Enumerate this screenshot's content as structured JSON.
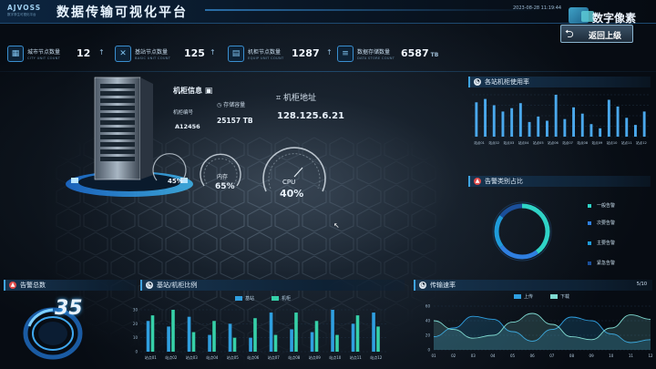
{
  "header": {
    "logo_brand": "AJVOSS",
    "logo_sub": "数字孪生可视化平台",
    "title": "数据传输可视化平台",
    "datetime": "2023-08-28 11:19:44",
    "watermark": "数字像素",
    "back_label": "返回上级"
  },
  "stats": [
    {
      "label": "城市节点数量",
      "en": "CITY UNIT COUNT",
      "value": "12",
      "unit": "",
      "icon": "city-icon"
    },
    {
      "label": "基站节点数量",
      "en": "BASIC UNIT COUNT",
      "value": "125",
      "unit": "",
      "icon": "tower-icon"
    },
    {
      "label": "机柜节点数量",
      "en": "EQUIP UNIT COUNT",
      "value": "1287",
      "unit": "",
      "icon": "cabinet-icon"
    },
    {
      "label": "数据存储数量",
      "en": "DATA STORE COUNT",
      "value": "6587",
      "unit": "TB",
      "icon": "database-icon"
    }
  ],
  "scene": {
    "cabinet_title": "机柜信息",
    "cabinet_no_label": "机柜编号",
    "cabinet_no": "A12456",
    "capacity_label": "存储容量",
    "capacity": "25157 TB",
    "ip_label": "机柜地址",
    "ip": "128.125.6.21",
    "gauge_small_value": "45%",
    "gauge_mid_label": "内存",
    "gauge_mid_value": "65%",
    "gauge_big_label": "CPU",
    "gauge_big_value": "40%"
  },
  "panels": {
    "cabinet_usage": {
      "title": "各站机柜使用率"
    },
    "alarm_types": {
      "title": "告警类别占比",
      "legend": [
        "一般告警",
        "次要告警",
        "主要告警",
        "紧急告警"
      ],
      "colors": [
        "#2fd3c6",
        "#2f7fe0",
        "#1f9bd9",
        "#1b4f9a"
      ]
    },
    "alarm_total": {
      "title": "告警总数",
      "value": "35"
    },
    "station_ratio": {
      "title": "基站/机柜比例",
      "legend": [
        "基站",
        "机柜"
      ],
      "colors": [
        "#2f9fe0",
        "#36d0a8"
      ]
    },
    "transfer_rate": {
      "title": "传输速率",
      "extra": "5/10",
      "legend": [
        "上传",
        "下载"
      ],
      "colors": [
        "#2f9fe0",
        "#7fd9d0"
      ]
    }
  },
  "chart_data": [
    {
      "type": "bar",
      "title": "各站机柜使用率",
      "categories": [
        "站点01",
        "站点02",
        "站点03",
        "站点04",
        "站点05",
        "站点06",
        "站点07",
        "站点08",
        "站点09",
        "站点10",
        "站点11",
        "站点12"
      ],
      "values": [
        82,
        90,
        75,
        60,
        68,
        80,
        35,
        48,
        38,
        100,
        42,
        70,
        55,
        30,
        20,
        88,
        72,
        45,
        28,
        60
      ],
      "ylim": [
        0,
        100
      ],
      "grid": true
    },
    {
      "type": "bar",
      "title": "基站/机柜比例",
      "categories": [
        "站点01",
        "站点02",
        "站点03",
        "站点04",
        "站点05",
        "站点06",
        "站点07",
        "站点08",
        "站点09",
        "站点10",
        "站点11",
        "站点12"
      ],
      "series": [
        {
          "name": "基站",
          "values": [
            22,
            18,
            25,
            12,
            20,
            10,
            28,
            16,
            14,
            30,
            20,
            28
          ]
        },
        {
          "name": "机柜",
          "values": [
            26,
            30,
            14,
            22,
            10,
            24,
            12,
            28,
            22,
            12,
            26,
            18
          ]
        }
      ],
      "ylim": [
        0,
        30
      ],
      "yticks": [
        "0",
        "10",
        "20",
        "30"
      ],
      "grid": true
    },
    {
      "type": "area",
      "title": "传输速率",
      "x": [
        "01",
        "02",
        "03",
        "04",
        "05",
        "06",
        "07",
        "08",
        "09",
        "10",
        "11",
        "12"
      ],
      "series": [
        {
          "name": "上传",
          "values": [
            18,
            30,
            46,
            42,
            25,
            12,
            28,
            45,
            40,
            22,
            10,
            14
          ]
        },
        {
          "name": "下载",
          "values": [
            40,
            28,
            16,
            20,
            38,
            50,
            35,
            18,
            14,
            30,
            48,
            42
          ]
        }
      ],
      "ylim": [
        0,
        60
      ],
      "yticks": [
        "0",
        "20",
        "40",
        "60"
      ],
      "grid": true
    },
    {
      "type": "pie",
      "title": "告警类别占比",
      "categories": [
        "一般告警",
        "次要告警",
        "主要告警",
        "紧急告警"
      ],
      "values": [
        40,
        25,
        20,
        15
      ]
    }
  ]
}
